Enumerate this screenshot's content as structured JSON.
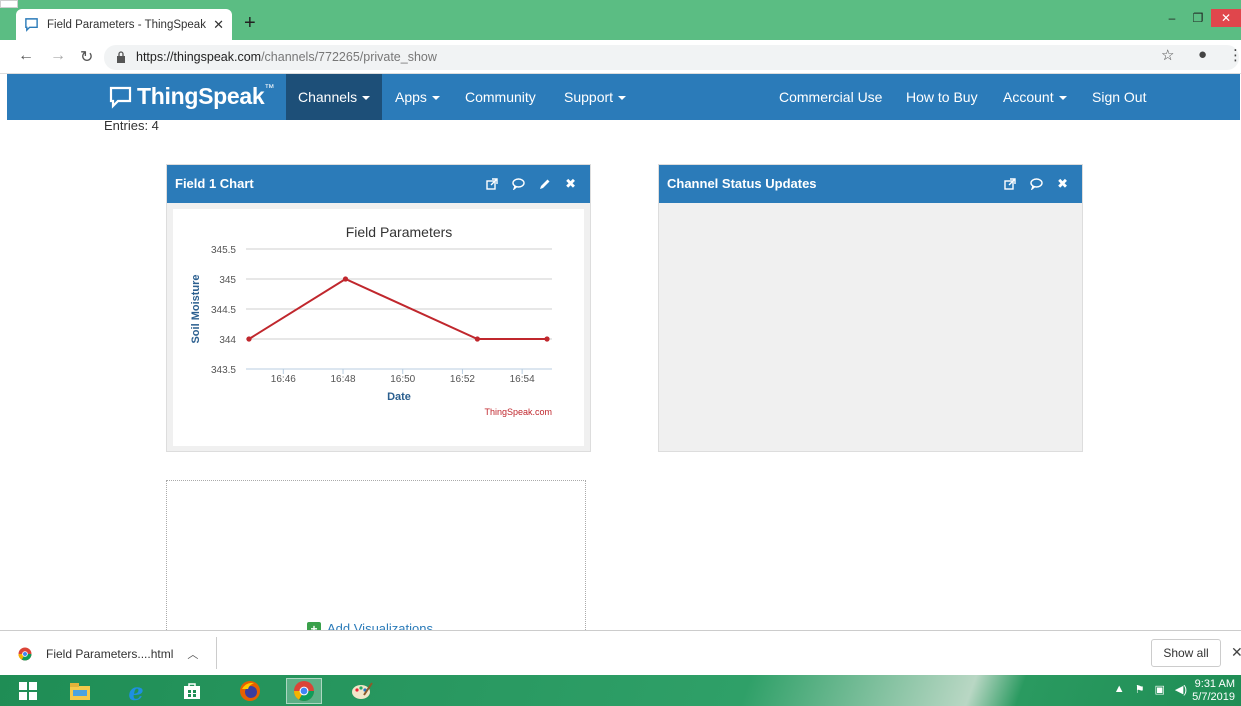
{
  "browser": {
    "tab_title": "Field Parameters - ThingSpeak Io",
    "url_host": "https://thingspeak.com",
    "url_path": "/channels/772265/private_show"
  },
  "navbar": {
    "brand": "ThingSpeak",
    "brand_tm": "™",
    "items": [
      "Channels",
      "Apps",
      "Community",
      "Support",
      "Commercial Use",
      "How to Buy",
      "Account",
      "Sign Out"
    ]
  },
  "page": {
    "entries": "Entries: 4"
  },
  "panels": {
    "field_chart_title": "Field 1 Chart",
    "status_title": "Channel Status Updates",
    "add_viz": "Add Visualizations"
  },
  "chart_data": {
    "type": "line",
    "title": "Field Parameters",
    "xlabel": "Date",
    "ylabel": "Soil Moisture",
    "credit": "ThingSpeak.com",
    "x_ticks": [
      "16:46",
      "16:48",
      "16:50",
      "16:52",
      "16:54"
    ],
    "y_ticks": [
      345.5,
      345,
      344.5,
      344,
      343.5
    ],
    "y_tick_labels": [
      "345.5",
      "345",
      "344.5",
      "344",
      "343.5"
    ],
    "ylim": [
      343.5,
      345.5
    ],
    "xlim": [
      "16:44:45",
      "16:55:00"
    ],
    "series": [
      {
        "color": "#c0272d",
        "x": [
          "16:44:51",
          "16:48:05",
          "16:52:30",
          "16:54:50"
        ],
        "values": [
          344,
          345,
          344,
          344
        ]
      }
    ]
  },
  "downloads": {
    "file": "Field Parameters....html",
    "show_all": "Show all"
  },
  "taskbar": {
    "time": "9:31 AM",
    "date": "5/7/2019"
  }
}
